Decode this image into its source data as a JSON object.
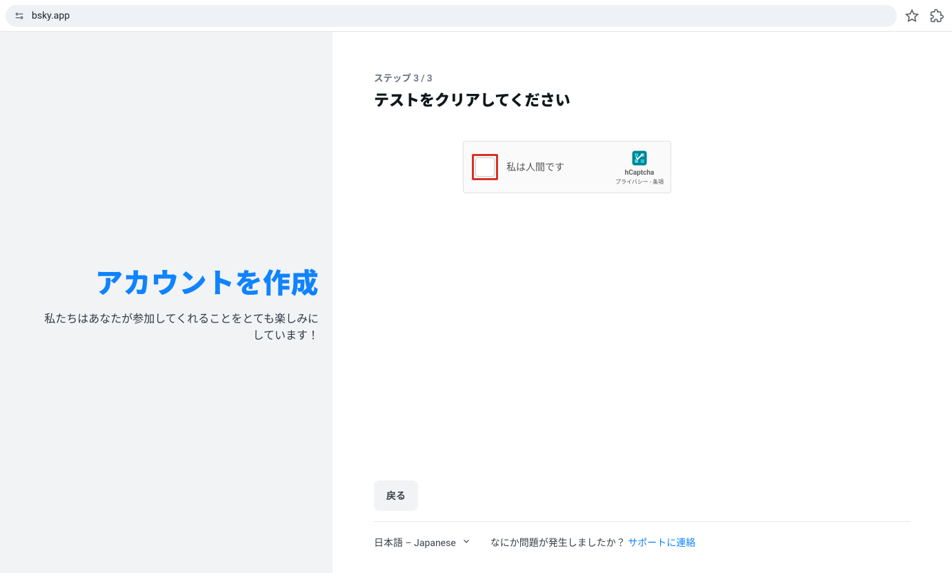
{
  "browser": {
    "url": "bsky.app"
  },
  "left": {
    "title": "アカウントを作成",
    "subtitle": "私たちはあなたが参加してくれることをとても楽しみにしています！"
  },
  "main": {
    "step_label": "ステップ 3 / 3",
    "headline": "テストをクリアしてください",
    "captcha": {
      "label": "私は人間です",
      "brand": "hCaptcha",
      "links": "プライバシー - 条項"
    },
    "back_label": "戻る"
  },
  "footer": {
    "language": "日本語 – Japanese",
    "problem": "なにか問題が発生しましたか？",
    "support": "サポートに連絡"
  }
}
